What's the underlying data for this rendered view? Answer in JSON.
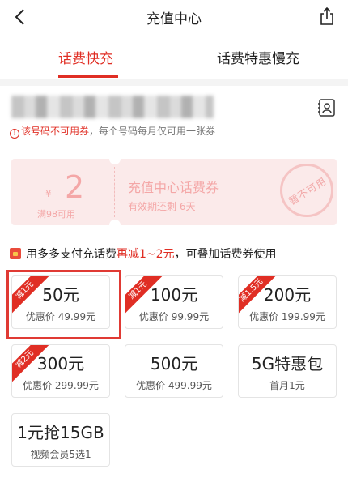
{
  "header": {
    "title": "充值中心"
  },
  "tabs": [
    {
      "label": "话费快充"
    },
    {
      "label": "话费特惠慢充"
    }
  ],
  "phone": {
    "warning_main": "该号码不可用券",
    "warning_note": "，每个号码每月仅可用一张券"
  },
  "coupon": {
    "currency": "¥",
    "amount": "2",
    "condition": "满98可用",
    "name": "充值中心话费券",
    "validity": "有效期还剩 6天",
    "stamp": "暂不可用"
  },
  "promo": {
    "prefix": "用多多支付充话费",
    "highlight": "再减1~2元",
    "suffix": "，可叠加话费券使用"
  },
  "options": [
    {
      "main": "50元",
      "sub": "优惠价 49.99元",
      "ribbon": "减1元"
    },
    {
      "main": "100元",
      "sub": "优惠价 99.99元",
      "ribbon": "减1元"
    },
    {
      "main": "200元",
      "sub": "优惠价 199.99元",
      "ribbon": "减1.5元"
    },
    {
      "main": "300元",
      "sub": "优惠价 299.99元",
      "ribbon": "减2元"
    },
    {
      "main": "500元",
      "sub": "优惠价 499.99元"
    },
    {
      "main": "5G特惠包",
      "sub": "首月1元"
    },
    {
      "main": "1元抢15GB",
      "sub": "视频会员5选1"
    }
  ],
  "colors": {
    "accent": "#e02e24",
    "coupon_bg": "#fbeaea"
  }
}
